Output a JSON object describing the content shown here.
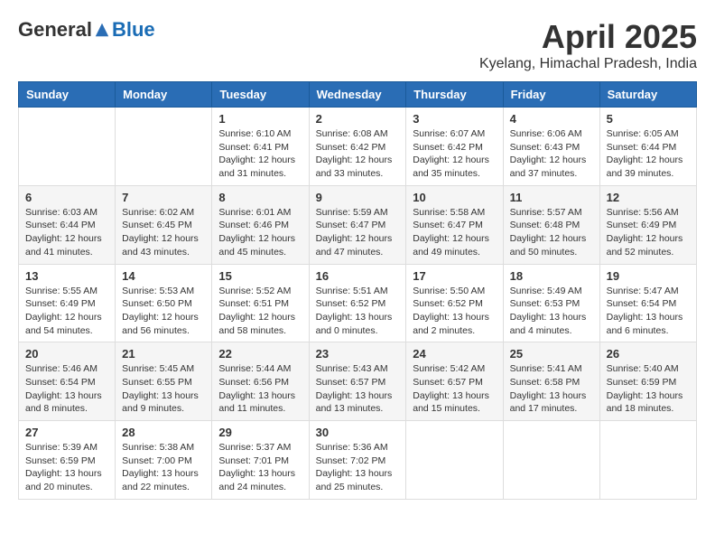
{
  "header": {
    "logo": {
      "general": "General",
      "blue": "Blue"
    },
    "title": "April 2025",
    "location": "Kyelang, Himachal Pradesh, India"
  },
  "weekdays": [
    "Sunday",
    "Monday",
    "Tuesday",
    "Wednesday",
    "Thursday",
    "Friday",
    "Saturday"
  ],
  "weeks": [
    [
      {
        "day": "",
        "sunrise": "",
        "sunset": "",
        "daylight": ""
      },
      {
        "day": "",
        "sunrise": "",
        "sunset": "",
        "daylight": ""
      },
      {
        "day": "1",
        "sunrise": "Sunrise: 6:10 AM",
        "sunset": "Sunset: 6:41 PM",
        "daylight": "Daylight: 12 hours and 31 minutes."
      },
      {
        "day": "2",
        "sunrise": "Sunrise: 6:08 AM",
        "sunset": "Sunset: 6:42 PM",
        "daylight": "Daylight: 12 hours and 33 minutes."
      },
      {
        "day": "3",
        "sunrise": "Sunrise: 6:07 AM",
        "sunset": "Sunset: 6:42 PM",
        "daylight": "Daylight: 12 hours and 35 minutes."
      },
      {
        "day": "4",
        "sunrise": "Sunrise: 6:06 AM",
        "sunset": "Sunset: 6:43 PM",
        "daylight": "Daylight: 12 hours and 37 minutes."
      },
      {
        "day": "5",
        "sunrise": "Sunrise: 6:05 AM",
        "sunset": "Sunset: 6:44 PM",
        "daylight": "Daylight: 12 hours and 39 minutes."
      }
    ],
    [
      {
        "day": "6",
        "sunrise": "Sunrise: 6:03 AM",
        "sunset": "Sunset: 6:44 PM",
        "daylight": "Daylight: 12 hours and 41 minutes."
      },
      {
        "day": "7",
        "sunrise": "Sunrise: 6:02 AM",
        "sunset": "Sunset: 6:45 PM",
        "daylight": "Daylight: 12 hours and 43 minutes."
      },
      {
        "day": "8",
        "sunrise": "Sunrise: 6:01 AM",
        "sunset": "Sunset: 6:46 PM",
        "daylight": "Daylight: 12 hours and 45 minutes."
      },
      {
        "day": "9",
        "sunrise": "Sunrise: 5:59 AM",
        "sunset": "Sunset: 6:47 PM",
        "daylight": "Daylight: 12 hours and 47 minutes."
      },
      {
        "day": "10",
        "sunrise": "Sunrise: 5:58 AM",
        "sunset": "Sunset: 6:47 PM",
        "daylight": "Daylight: 12 hours and 49 minutes."
      },
      {
        "day": "11",
        "sunrise": "Sunrise: 5:57 AM",
        "sunset": "Sunset: 6:48 PM",
        "daylight": "Daylight: 12 hours and 50 minutes."
      },
      {
        "day": "12",
        "sunrise": "Sunrise: 5:56 AM",
        "sunset": "Sunset: 6:49 PM",
        "daylight": "Daylight: 12 hours and 52 minutes."
      }
    ],
    [
      {
        "day": "13",
        "sunrise": "Sunrise: 5:55 AM",
        "sunset": "Sunset: 6:49 PM",
        "daylight": "Daylight: 12 hours and 54 minutes."
      },
      {
        "day": "14",
        "sunrise": "Sunrise: 5:53 AM",
        "sunset": "Sunset: 6:50 PM",
        "daylight": "Daylight: 12 hours and 56 minutes."
      },
      {
        "day": "15",
        "sunrise": "Sunrise: 5:52 AM",
        "sunset": "Sunset: 6:51 PM",
        "daylight": "Daylight: 12 hours and 58 minutes."
      },
      {
        "day": "16",
        "sunrise": "Sunrise: 5:51 AM",
        "sunset": "Sunset: 6:52 PM",
        "daylight": "Daylight: 13 hours and 0 minutes."
      },
      {
        "day": "17",
        "sunrise": "Sunrise: 5:50 AM",
        "sunset": "Sunset: 6:52 PM",
        "daylight": "Daylight: 13 hours and 2 minutes."
      },
      {
        "day": "18",
        "sunrise": "Sunrise: 5:49 AM",
        "sunset": "Sunset: 6:53 PM",
        "daylight": "Daylight: 13 hours and 4 minutes."
      },
      {
        "day": "19",
        "sunrise": "Sunrise: 5:47 AM",
        "sunset": "Sunset: 6:54 PM",
        "daylight": "Daylight: 13 hours and 6 minutes."
      }
    ],
    [
      {
        "day": "20",
        "sunrise": "Sunrise: 5:46 AM",
        "sunset": "Sunset: 6:54 PM",
        "daylight": "Daylight: 13 hours and 8 minutes."
      },
      {
        "day": "21",
        "sunrise": "Sunrise: 5:45 AM",
        "sunset": "Sunset: 6:55 PM",
        "daylight": "Daylight: 13 hours and 9 minutes."
      },
      {
        "day": "22",
        "sunrise": "Sunrise: 5:44 AM",
        "sunset": "Sunset: 6:56 PM",
        "daylight": "Daylight: 13 hours and 11 minutes."
      },
      {
        "day": "23",
        "sunrise": "Sunrise: 5:43 AM",
        "sunset": "Sunset: 6:57 PM",
        "daylight": "Daylight: 13 hours and 13 minutes."
      },
      {
        "day": "24",
        "sunrise": "Sunrise: 5:42 AM",
        "sunset": "Sunset: 6:57 PM",
        "daylight": "Daylight: 13 hours and 15 minutes."
      },
      {
        "day": "25",
        "sunrise": "Sunrise: 5:41 AM",
        "sunset": "Sunset: 6:58 PM",
        "daylight": "Daylight: 13 hours and 17 minutes."
      },
      {
        "day": "26",
        "sunrise": "Sunrise: 5:40 AM",
        "sunset": "Sunset: 6:59 PM",
        "daylight": "Daylight: 13 hours and 18 minutes."
      }
    ],
    [
      {
        "day": "27",
        "sunrise": "Sunrise: 5:39 AM",
        "sunset": "Sunset: 6:59 PM",
        "daylight": "Daylight: 13 hours and 20 minutes."
      },
      {
        "day": "28",
        "sunrise": "Sunrise: 5:38 AM",
        "sunset": "Sunset: 7:00 PM",
        "daylight": "Daylight: 13 hours and 22 minutes."
      },
      {
        "day": "29",
        "sunrise": "Sunrise: 5:37 AM",
        "sunset": "Sunset: 7:01 PM",
        "daylight": "Daylight: 13 hours and 24 minutes."
      },
      {
        "day": "30",
        "sunrise": "Sunrise: 5:36 AM",
        "sunset": "Sunset: 7:02 PM",
        "daylight": "Daylight: 13 hours and 25 minutes."
      },
      {
        "day": "",
        "sunrise": "",
        "sunset": "",
        "daylight": ""
      },
      {
        "day": "",
        "sunrise": "",
        "sunset": "",
        "daylight": ""
      },
      {
        "day": "",
        "sunrise": "",
        "sunset": "",
        "daylight": ""
      }
    ]
  ]
}
